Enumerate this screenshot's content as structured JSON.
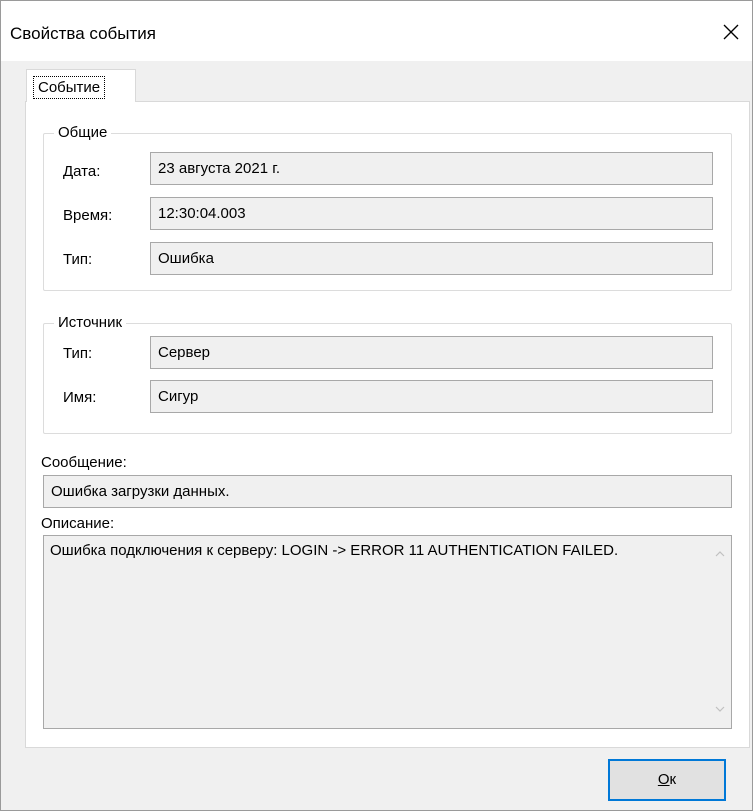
{
  "window": {
    "title": "Свойства события"
  },
  "tabs": [
    {
      "label": "Событие"
    }
  ],
  "general": {
    "title": "Общие",
    "rows": [
      {
        "label": "Дата:",
        "value": "23 августа 2021 г."
      },
      {
        "label": "Время:",
        "value": "12:30:04.003"
      },
      {
        "label": "Тип:",
        "value": "Ошибка"
      }
    ]
  },
  "source": {
    "title": "Источник",
    "rows": [
      {
        "label": "Тип:",
        "value": "Сервер"
      },
      {
        "label": "Имя:",
        "value": "Сигур"
      }
    ]
  },
  "message": {
    "label": "Сообщение:",
    "value": "Ошибка загрузки данных."
  },
  "description": {
    "label": "Описание:",
    "value": "Ошибка подключения к серверу: LOGIN -> ERROR 11 AUTHENTICATION FAILED."
  },
  "buttons": {
    "ok_first": "О",
    "ok_rest": "к"
  },
  "icons": {
    "close": "close-icon",
    "scroll_up": "chevron-up-icon",
    "scroll_down": "chevron-down-icon"
  },
  "colors": {
    "focus_border": "#0078d7",
    "field_bg": "#f0f0f0",
    "panel_bg": "#ffffff"
  }
}
